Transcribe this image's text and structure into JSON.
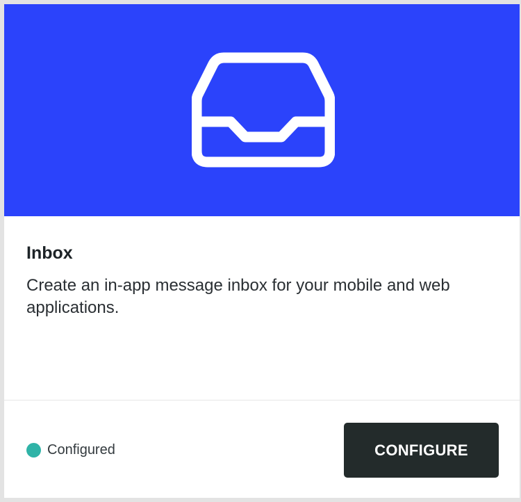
{
  "card": {
    "icon": "inbox-icon",
    "title": "Inbox",
    "description": "Create an in-app message inbox for your mobile and web applications.",
    "status": {
      "label": "Configured",
      "color": "#2fb3a7"
    },
    "configure_button": {
      "label": "CONFIGURE"
    }
  },
  "colors": {
    "hero_background": "#2b43fb",
    "button_background": "#232b2b",
    "icon_stroke": "#ffffff"
  }
}
